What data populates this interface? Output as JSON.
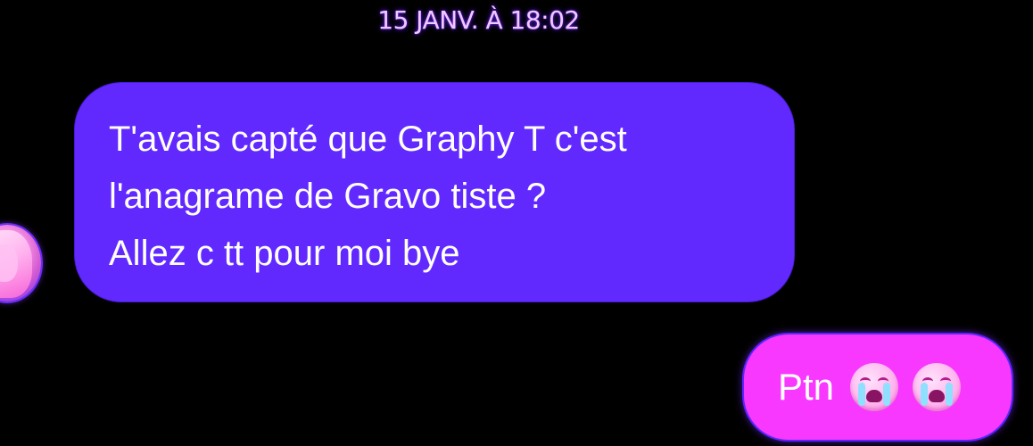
{
  "conversation": {
    "timestamp": "15 JANV. À 18:02",
    "incoming": {
      "avatar_icon": "user-avatar",
      "lines": [
        "T'avais capté que Graphy T c'est",
        "l'anagrame de Gravo tiste ?",
        "Allez c tt pour moi bye"
      ]
    },
    "outgoing": {
      "text": "Ptn",
      "emojis": [
        "loudly-crying-face-emoji",
        "loudly-crying-face-emoji"
      ]
    }
  },
  "colors": {
    "background": "#000000",
    "incoming_bubble": "#6229ff",
    "outgoing_bubble": "#f838ff",
    "timestamp_text": "#f4c6ff",
    "message_text": "#ffffff"
  }
}
